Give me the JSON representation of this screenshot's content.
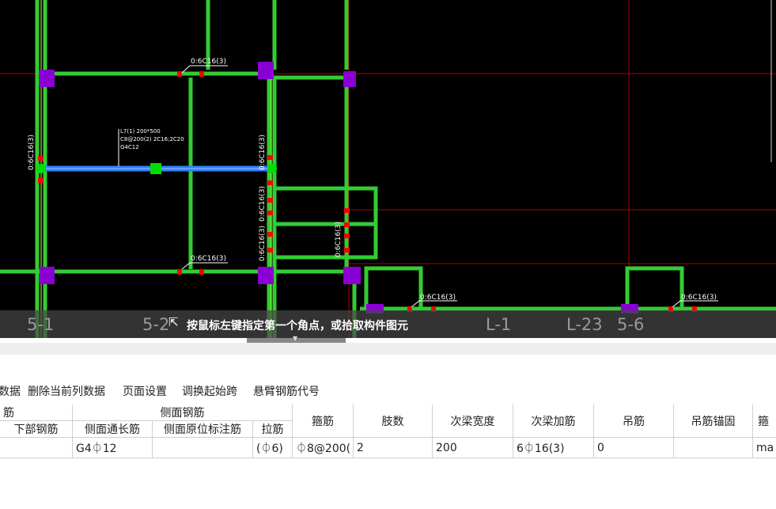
{
  "cad": {
    "annotations": {
      "top_beam": "0:6C16(3)",
      "left_col": "0:6C16(3)",
      "right_col": "0:6C16(3)",
      "mid_col_a": "0:6C16(3)",
      "mid_col_b": "0:6C16(3)",
      "mid_col_c": "0:6C16(3)",
      "bottom_beam": "0:6C16(3)",
      "bottom_right_a": "0:6C16(3)",
      "bottom_right_b": "0:6C16(3)",
      "beam_info_1": "L7(1) 200*500",
      "beam_info_2": "C8@200(2) 2C16;2C20",
      "beam_info_3": "G4C12"
    },
    "axis_labels": [
      "5-1",
      "5-2",
      "L-1",
      "L-23",
      "5-6"
    ],
    "status_message": "按鼠标左键指定第一个角点，或拾取构件图元",
    "colors": {
      "background": "#000000",
      "beam": "#33cc33",
      "column": "#8a00d4",
      "selected_beam": "#2f7fff",
      "grid_line": "#b00000",
      "rebar_mark": "#ff0000"
    }
  },
  "toolbar": {
    "items": [
      "数据",
      "删除当前列数据",
      "页面设置",
      "调换起始跨",
      "悬臂钢筋代号"
    ]
  },
  "grid": {
    "group_headers": {
      "bottom": "筋",
      "side": "侧面钢筋"
    },
    "columns": {
      "bottom_rebar": "下部钢筋",
      "side_through": "侧面通长筋",
      "side_inplace": "侧面原位标注筋",
      "tie": "拉筋",
      "stirrup": "箍筋",
      "legs": "肢数",
      "sec_width": "次梁宽度",
      "sec_add": "次梁加筋",
      "hanger": "吊筋",
      "hanger_anchor": "吊筋锚固",
      "last": "箍"
    },
    "row": {
      "bottom_rebar": "",
      "side_through": "G4⏀12",
      "side_inplace": "",
      "tie": "(⏀6)",
      "stirrup": "⏀8@200(",
      "legs": "2",
      "sec_width": "200",
      "sec_add": "6⏀16(3)",
      "hanger": "0",
      "hanger_anchor": "",
      "last": "ma"
    }
  }
}
